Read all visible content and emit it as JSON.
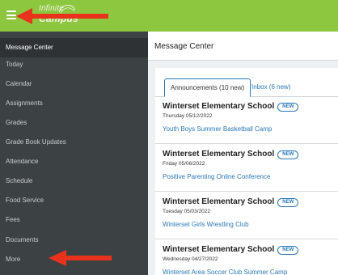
{
  "app": {
    "logo_line1": "Infinite",
    "logo_line2": "Campus",
    "brand_color": "#8dc63f",
    "icon": "hamburger-menu-icon"
  },
  "sidebar": {
    "items": [
      {
        "label": "Message Center",
        "active": true
      },
      {
        "label": "Today"
      },
      {
        "label": "Calendar"
      },
      {
        "label": "Assignments"
      },
      {
        "label": "Grades"
      },
      {
        "label": "Grade Book Updates"
      },
      {
        "label": "Attendance"
      },
      {
        "label": "Schedule"
      },
      {
        "label": "Food Service"
      },
      {
        "label": "Fees"
      },
      {
        "label": "Documents"
      },
      {
        "label": "More"
      }
    ]
  },
  "main": {
    "title": "Message Center",
    "tabs": [
      {
        "label": "Announcements (10 new)",
        "active": true
      },
      {
        "label": "Inbox (6 new)"
      }
    ],
    "messages": [
      {
        "school": "Winterset Elementary School",
        "badge": "NEW",
        "date": "Thursday 05/12/2022",
        "link": "Youth Boys Summer Basketball Camp"
      },
      {
        "school": "Winterset Elementary School",
        "badge": "NEW",
        "date": "Friday 05/06/2022",
        "link": "Positive Parenting Online Conference"
      },
      {
        "school": "Winterset Elementary School",
        "badge": "NEW",
        "date": "Tuesday 05/03/2022",
        "link": "Winterset Girls Wrestling Club"
      },
      {
        "school": "Winterset Elementary School",
        "badge": "NEW",
        "date": "Wednesday 04/27/2022",
        "link": "Winterset Area Soccer Club Summer Camp"
      }
    ]
  },
  "annotations": {
    "arrow_color": "#e8321c"
  }
}
